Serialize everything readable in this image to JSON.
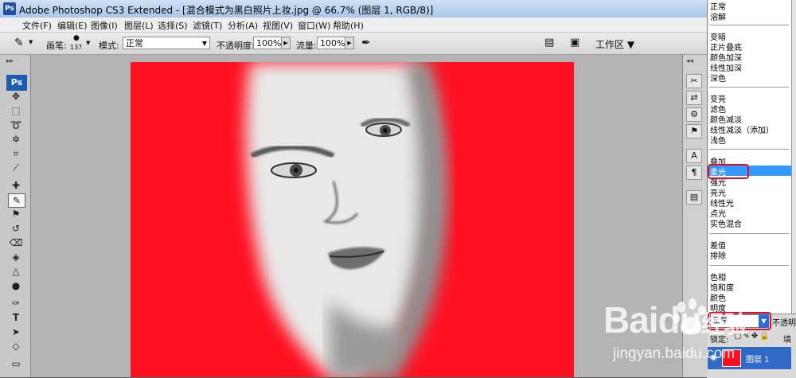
{
  "window": {
    "app_icon": "Ps",
    "title": "Adobe Photoshop CS3 Extended - [混合模式为黑白照片上妆.jpg @ 66.7% (图层 1, RGB/8)]"
  },
  "menu": [
    "文件(F)",
    "编辑(E)",
    "图像(I)",
    "图层(L)",
    "选择(S)",
    "滤镜(T)",
    "分析(A)",
    "视图(V)",
    "窗口(W)",
    "帮助(H)"
  ],
  "options": {
    "brush_label": "画笔:",
    "brush_size": "137",
    "mode_label": "模式:",
    "mode_value": "正常",
    "opacity_label": "不透明度:",
    "opacity_value": "100%",
    "flow_label": "流量:",
    "flow_value": "100%",
    "workspace_label": "工作区 ▼"
  },
  "toolbox": {
    "logo": "Ps"
  },
  "blend_modes": {
    "groups": [
      [
        "正常",
        "溶解"
      ],
      [
        "变暗",
        "正片叠底",
        "颜色加深",
        "线性加深",
        "深色"
      ],
      [
        "变亮",
        "滤色",
        "颜色减淡",
        "线性减淡（添加）",
        "浅色"
      ],
      [
        "叠加",
        "柔光",
        "强光",
        "亮光",
        "线性光",
        "点光",
        "实色混合"
      ],
      [
        "差值",
        "排除"
      ],
      [
        "色相",
        "饱和度",
        "颜色",
        "明度"
      ]
    ],
    "selected": "柔光"
  },
  "layers": {
    "mode_value": "正常",
    "opacity_label": "不透明度",
    "lock_label": "锁定:",
    "fill_label": "填",
    "layer_name": "图层 1"
  },
  "watermark": {
    "brand": "Baidu",
    "suffix": "经验",
    "url": "jingyan.baidu.com"
  },
  "colors": {
    "accent_red": "#ff1020",
    "selection_blue": "#3399ff",
    "highlight_box": "#e0102a"
  }
}
